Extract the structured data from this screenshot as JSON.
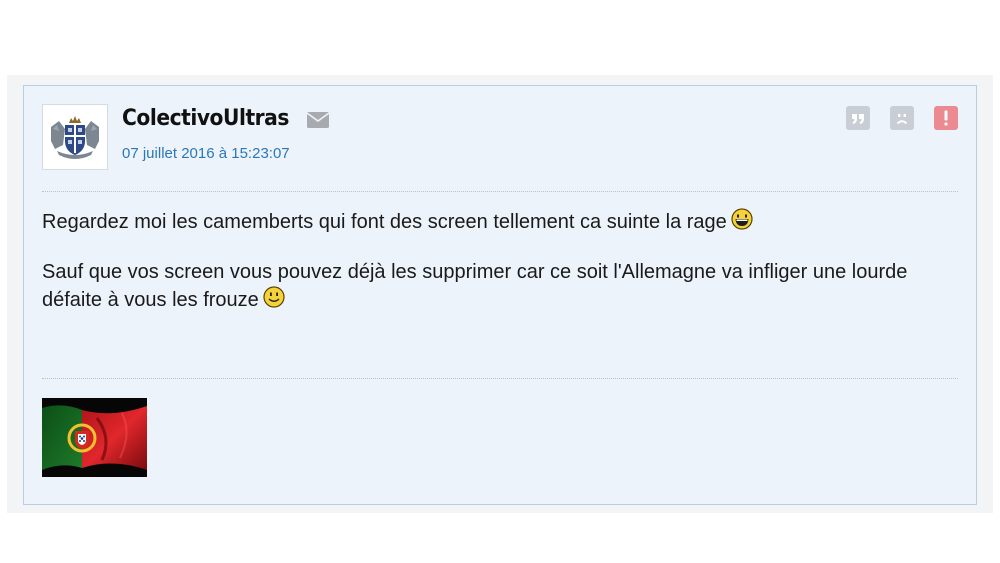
{
  "post": {
    "author": {
      "username": "ColectivoUltras",
      "avatar_icon": "crest-icon",
      "mail_icon": "envelope-icon"
    },
    "date": "07 juillet 2016 à 15:23:07",
    "actions": [
      {
        "name": "quote",
        "icon": "quote-icon",
        "color": "#c9ced4"
      },
      {
        "name": "dislike",
        "icon": "sad-face-icon",
        "color": "#c9ced4"
      },
      {
        "name": "report",
        "icon": "exclamation-icon",
        "color": "#ec8a91"
      }
    ],
    "paragraphs": [
      {
        "text": "Regardez moi les camemberts qui font des screen tellement ca suinte la rage",
        "emoji": "laughing-smiley-icon"
      },
      {
        "text": "Sauf que vos screen vous pouvez déjà les supprimer car ce soit l'Allemagne va infliger une lourde défaite à vous les frouze",
        "emoji": "smiley-icon"
      }
    ],
    "signature": {
      "image": "portugal-flag"
    }
  },
  "colors": {
    "link": "#2a78b8",
    "post_background": "#edf3fb",
    "post_border": "#b9cde3"
  }
}
